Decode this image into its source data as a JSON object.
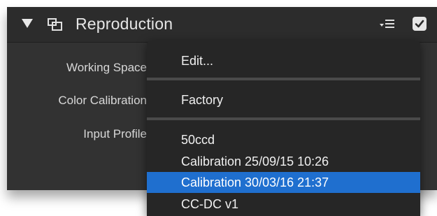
{
  "panel": {
    "title": "Reproduction",
    "enabled": true
  },
  "rows": [
    {
      "label": "Working Space"
    },
    {
      "label": "Color Calibration"
    },
    {
      "label": "Input Profile"
    }
  ],
  "menu": {
    "items": [
      {
        "label": "Edit...",
        "checked": false,
        "selected": false
      },
      {
        "label": "Factory",
        "checked": true,
        "selected": false
      },
      {
        "label": "50ccd",
        "checked": false,
        "selected": false
      },
      {
        "label": "Calibration 25/09/15 10:26",
        "checked": false,
        "selected": false
      },
      {
        "label": "Calibration 30/03/16 21:37",
        "checked": false,
        "selected": true
      },
      {
        "label": "CC-DC v1",
        "checked": false,
        "selected": false
      }
    ],
    "checkmark_glyph": "✓"
  },
  "icons": {
    "disclosure": "disclosure-triangle-icon",
    "module": "module-icon",
    "presets": "presets-menu-icon",
    "enable": "enable-checkbox-icon",
    "stepper": "up-down-stepper-icon"
  },
  "colors": {
    "panel_bg": "#323232",
    "menu_bg": "#262626",
    "selection": "#1f6fcf",
    "text": "#d8d8d8"
  }
}
